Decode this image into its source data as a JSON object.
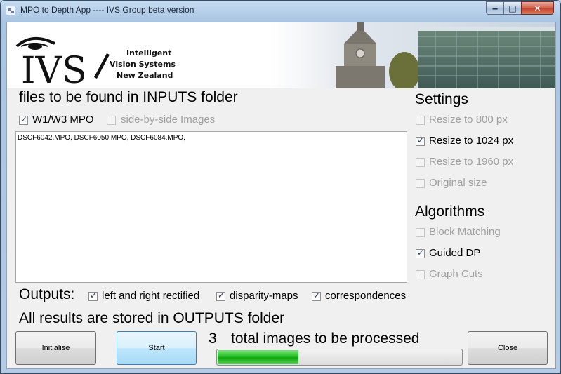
{
  "window": {
    "title": "MPO to Depth App ---- IVS Group beta version"
  },
  "title_controls": {
    "minimize": "‒",
    "maximize": "□",
    "close": "✕"
  },
  "banner": {
    "logo_letters": "IVS",
    "logo_lines": [
      "Intelligent",
      "Vision Systems",
      "New Zealand"
    ]
  },
  "inputs": {
    "heading": "files to be found in INPUTS folder",
    "w1w3_label": "W1/W3 MPO",
    "w1w3_checked": true,
    "sidebyside_label": "side-by-side Images",
    "sidebyside_checked": false,
    "file_list": "DSCF6042.MPO, DSCF6050.MPO, DSCF6084.MPO,"
  },
  "settings": {
    "heading": "Settings",
    "options": [
      {
        "label": "Resize to 800 px",
        "checked": false,
        "enabled": false
      },
      {
        "label": "Resize to 1024 px",
        "checked": true,
        "enabled": true
      },
      {
        "label": "Resize to 1960 px",
        "checked": false,
        "enabled": false
      },
      {
        "label": "Original size",
        "checked": false,
        "enabled": false
      }
    ]
  },
  "algorithms": {
    "heading": "Algorithms",
    "options": [
      {
        "label": "Block Matching",
        "checked": false,
        "enabled": false
      },
      {
        "label": "Guided DP",
        "checked": true,
        "enabled": true
      },
      {
        "label": "Graph Cuts",
        "checked": false,
        "enabled": false
      }
    ]
  },
  "outputs": {
    "label": "Outputs:",
    "options": [
      {
        "label": "left and right rectified",
        "checked": true
      },
      {
        "label": "disparity-maps",
        "checked": true
      },
      {
        "label": "correspondences",
        "checked": true
      }
    ],
    "note": "All results are stored in OUTPUTS folder"
  },
  "status": {
    "count": "3",
    "text": "total images to be processed",
    "progress_fraction": 0.33
  },
  "buttons": {
    "initialise": "Initialise",
    "start": "Start",
    "close": "Close"
  },
  "colors": {
    "progress_green": "#22b822",
    "title_bar": "#b4cbe5"
  }
}
